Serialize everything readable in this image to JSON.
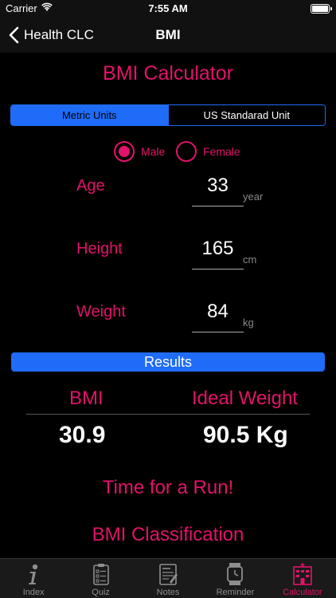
{
  "status_bar": {
    "carrier": "Carrier",
    "time": "7:55 AM"
  },
  "nav": {
    "back_label": "Health CLC",
    "title": "BMI"
  },
  "calculator": {
    "title": "BMI Calculator",
    "units": {
      "metric": "Metric Units",
      "us": "US Standarad Unit",
      "selected": "metric"
    },
    "gender": {
      "male": "Male",
      "female": "Female",
      "selected": "male"
    },
    "fields": {
      "age": {
        "label": "Age",
        "value": "33",
        "unit": "year"
      },
      "height": {
        "label": "Height",
        "value": "165",
        "unit": "cm"
      },
      "weight": {
        "label": "Weight",
        "value": "84",
        "unit": "kg"
      }
    }
  },
  "results": {
    "header": "Results",
    "bmi_label": "BMI",
    "bmi_value": "30.9",
    "ideal_label": "Ideal Weight",
    "ideal_value": "90.5 Kg",
    "message": "Time for a Run!",
    "classification_title": "BMI Classification"
  },
  "tabs": [
    {
      "label": "Index",
      "icon": "info-icon"
    },
    {
      "label": "Quiz",
      "icon": "clipboard-icon"
    },
    {
      "label": "Notes",
      "icon": "notes-icon"
    },
    {
      "label": "Reminder",
      "icon": "watch-icon"
    },
    {
      "label": "Calculator",
      "icon": "building-icon",
      "active": true
    }
  ],
  "colors": {
    "accent": "#e3126a",
    "blue": "#1e6cf7",
    "background": "#000000"
  }
}
